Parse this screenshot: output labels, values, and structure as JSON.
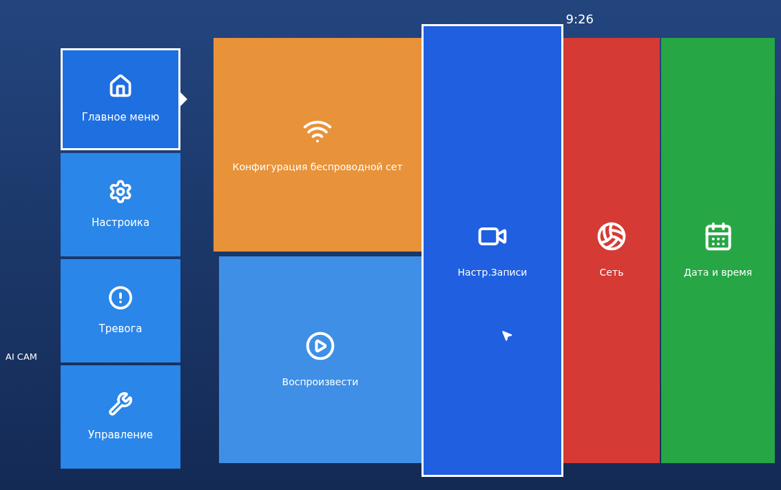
{
  "clock": "9:26",
  "camera_label": "AI CAM",
  "sidebar": {
    "items": [
      {
        "kind": "home",
        "label": "Главное меню",
        "selected": true
      },
      {
        "kind": "settings",
        "label": "Настроика",
        "selected": false
      },
      {
        "kind": "alarm",
        "label": "Тревога",
        "selected": false
      },
      {
        "kind": "tools",
        "label": "Управление",
        "selected": false
      }
    ]
  },
  "tiles": [
    {
      "kind": "wifi",
      "label": "Конфигурация беспроводной сет",
      "color": "#e8923a",
      "selected": false
    },
    {
      "kind": "play",
      "label": "Воспроизвести",
      "color": "#3f8fe6",
      "selected": false
    },
    {
      "kind": "record",
      "label": "Настр.Записи",
      "color": "#1f5fe0",
      "selected": true
    },
    {
      "kind": "network",
      "label": "Сеть",
      "color": "#d63a34",
      "selected": false
    },
    {
      "kind": "date",
      "label": "Дата и время",
      "color": "#27a645",
      "selected": false
    }
  ]
}
